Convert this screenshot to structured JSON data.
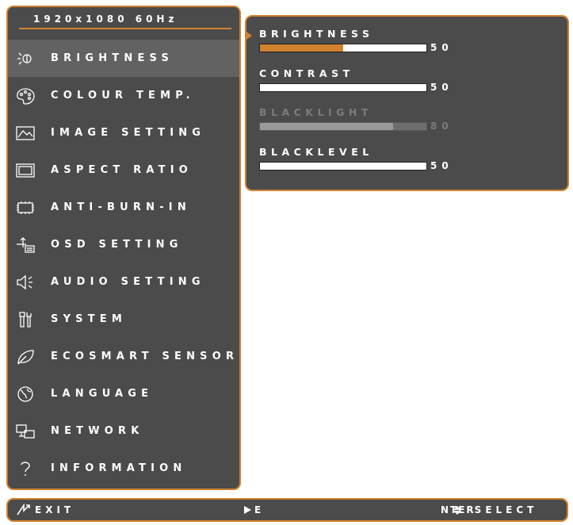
{
  "header": {
    "resolution": "1920x1080 60Hz"
  },
  "menu": {
    "items": [
      {
        "label": "BRIGHTNESS",
        "icon": "brightness-icon",
        "selected": true
      },
      {
        "label": "COLOUR TEMP.",
        "icon": "palette-icon"
      },
      {
        "label": "IMAGE SETTING",
        "icon": "image-icon"
      },
      {
        "label": "ASPECT RATIO",
        "icon": "aspect-ratio-icon"
      },
      {
        "label": "ANTI-BURN-IN",
        "icon": "chip-icon"
      },
      {
        "label": "OSD SETTING",
        "icon": "osd-icon"
      },
      {
        "label": "AUDIO SETTING",
        "icon": "speaker-icon"
      },
      {
        "label": "SYSTEM",
        "icon": "tools-icon"
      },
      {
        "label": "ECOSMART SENSOR",
        "icon": "leaf-icon"
      },
      {
        "label": "LANGUAGE",
        "icon": "globe-icon"
      },
      {
        "label": "NETWORK",
        "icon": "network-icon"
      },
      {
        "label": "INFORMATION",
        "icon": "question-icon"
      }
    ]
  },
  "submenu": {
    "rows": [
      {
        "label": "BRIGHTNESS",
        "value": "50",
        "level": 0.5,
        "selected": true
      },
      {
        "label": "CONTRAST",
        "value": "50",
        "level": 0.5
      },
      {
        "label": "BLACKLIGHT",
        "value": "80",
        "level": 0.8,
        "disabled": true
      },
      {
        "label": "BLACKLEVEL",
        "value": "50",
        "level": 0.5
      }
    ]
  },
  "footer": {
    "exit_label": "EXIT",
    "enter_label": "E",
    "nav_label": "NTER",
    "select_label": "SELECT"
  },
  "colors": {
    "accent": "#d1822e",
    "panel": "#4b4b4b",
    "highlight": "#626262"
  }
}
